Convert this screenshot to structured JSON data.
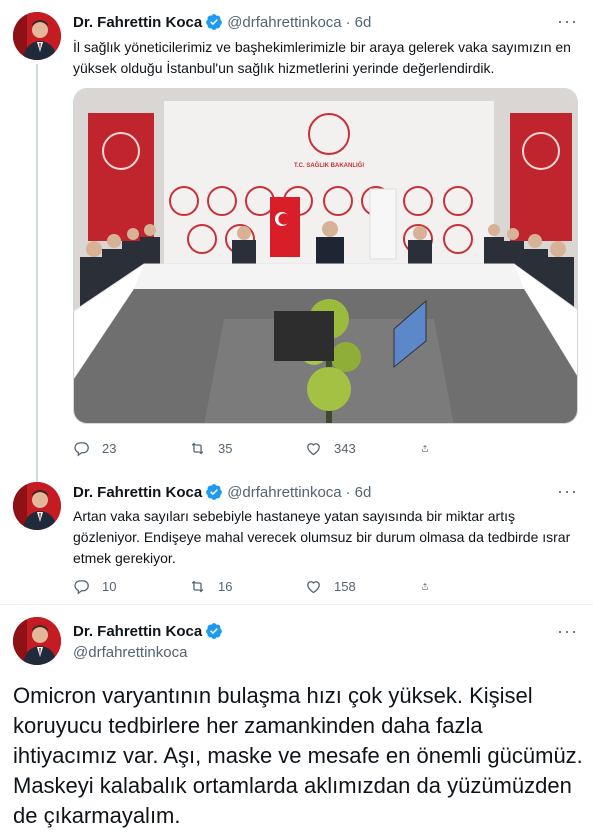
{
  "tweets": [
    {
      "name": "Dr. Fahrettin Koca",
      "handle": "@drfahrettinkoca",
      "time": "6d",
      "text": "İl sağlık yöneticilerimiz ve başhekimlerimizle bir araya gelerek vaka sayımızın en yüksek olduğu İstanbul'un sağlık hizmetlerini yerinde değerlendirdik.",
      "replies": "23",
      "retweets": "35",
      "likes": "343",
      "photo_text": {
        "banner_org": "T.C. SAĞLIK BAKANLIĞI",
        "side_banner": "T.C. SAĞLIK BAKANLIĞI"
      }
    },
    {
      "name": "Dr. Fahrettin Koca",
      "handle": "@drfahrettinkoca",
      "time": "6d",
      "text": "Artan vaka sayıları sebebiyle hastaneye yatan sayısında bir miktar artış gözleniyor. Endişeye mahal verecek olumsuz bir durum olmasa da tedbirde ısrar etmek gerekiyor.",
      "replies": "10",
      "retweets": "16",
      "likes": "158"
    },
    {
      "name": "Dr. Fahrettin Koca",
      "handle": "@drfahrettinkoca",
      "text": "Omicron varyantının bulaşma hızı çok yüksek. Kişisel koruyucu tedbirlere her zamankinden daha fazla ihtiyacımız var. Aşı, maske ve mesafe en önemli gücümüz. Maskeyi kalabalık ortamlarda aklımızdan da yüzümüzden de çıkarmayalım."
    }
  ],
  "icons": {
    "verified": "verified-badge-icon",
    "more": "more-icon",
    "reply": "reply-icon",
    "retweet": "retweet-icon",
    "like": "like-icon",
    "share": "share-icon"
  },
  "colors": {
    "verified_blue": "#1d9bf0",
    "secondary_text": "#536471",
    "avatar_red": "#b7191f"
  }
}
